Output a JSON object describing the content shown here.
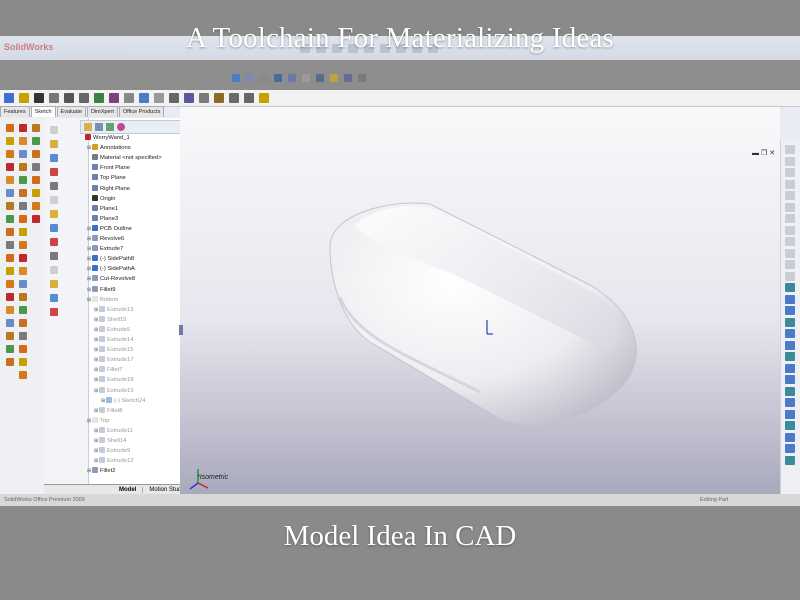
{
  "slide": {
    "title": "A Toolchain For Materializing Ideas",
    "caption": "Model Idea In CAD"
  },
  "app": {
    "name": "SolidWorks",
    "tabs": [
      "Features",
      "Sketch",
      "Evaluate",
      "DimXpert",
      "Office Products"
    ],
    "active_tab": "Sketch"
  },
  "feature_tree": {
    "items": [
      {
        "label": "WorryWand_1",
        "level": 0,
        "dim": false,
        "icon": "part-icon"
      },
      {
        "label": "Annotations",
        "level": 1,
        "dim": false,
        "icon": "annotations-icon"
      },
      {
        "label": "Material <not specified>",
        "level": 1,
        "dim": false,
        "icon": "material-icon"
      },
      {
        "label": "Front Plane",
        "level": 1,
        "dim": false,
        "icon": "plane-icon"
      },
      {
        "label": "Top Plane",
        "level": 1,
        "dim": false,
        "icon": "plane-icon"
      },
      {
        "label": "Right Plane",
        "level": 1,
        "dim": false,
        "icon": "plane-icon"
      },
      {
        "label": "Origin",
        "level": 1,
        "dim": false,
        "icon": "origin-icon"
      },
      {
        "label": "Plane1",
        "level": 1,
        "dim": false,
        "icon": "plane-icon"
      },
      {
        "label": "Plane3",
        "level": 1,
        "dim": false,
        "icon": "plane-icon"
      },
      {
        "label": "PCB Outline",
        "level": 1,
        "dim": false,
        "icon": "sketch-icon"
      },
      {
        "label": "Revolve6",
        "level": 1,
        "dim": false,
        "icon": "feature-icon"
      },
      {
        "label": "Extrude7",
        "level": 1,
        "dim": false,
        "icon": "feature-icon"
      },
      {
        "label": "(-) SidePath8",
        "level": 1,
        "dim": false,
        "icon": "sketch-icon"
      },
      {
        "label": "(-) SidePathA",
        "level": 1,
        "dim": false,
        "icon": "sketch-icon"
      },
      {
        "label": "Cut-Revolve8",
        "level": 1,
        "dim": false,
        "icon": "feature-icon"
      },
      {
        "label": "Fillet9",
        "level": 1,
        "dim": false,
        "icon": "feature-icon"
      },
      {
        "label": "Bottom",
        "level": 1,
        "dim": true,
        "icon": "folder-icon"
      },
      {
        "label": "Extrude13",
        "level": 2,
        "dim": true,
        "icon": "feature-icon"
      },
      {
        "label": "Shell15",
        "level": 2,
        "dim": true,
        "icon": "feature-icon"
      },
      {
        "label": "Extrude5",
        "level": 2,
        "dim": true,
        "icon": "feature-icon"
      },
      {
        "label": "Extrude14",
        "level": 2,
        "dim": true,
        "icon": "feature-icon"
      },
      {
        "label": "Extrude15",
        "level": 2,
        "dim": true,
        "icon": "feature-icon"
      },
      {
        "label": "Extrude17",
        "level": 2,
        "dim": true,
        "icon": "feature-icon"
      },
      {
        "label": "Fillet7",
        "level": 2,
        "dim": true,
        "icon": "feature-icon"
      },
      {
        "label": "Extrude18",
        "level": 2,
        "dim": true,
        "icon": "feature-icon"
      },
      {
        "label": "Extrude19",
        "level": 2,
        "dim": true,
        "icon": "feature-icon"
      },
      {
        "label": "(-) Sketch24",
        "level": 3,
        "dim": true,
        "icon": "sketch-icon"
      },
      {
        "label": "Fillet8",
        "level": 2,
        "dim": true,
        "icon": "feature-icon"
      },
      {
        "label": "Top",
        "level": 1,
        "dim": true,
        "icon": "folder-icon"
      },
      {
        "label": "Extrude11",
        "level": 2,
        "dim": true,
        "icon": "feature-icon"
      },
      {
        "label": "Shell14",
        "level": 2,
        "dim": true,
        "icon": "feature-icon"
      },
      {
        "label": "Extrude9",
        "level": 2,
        "dim": true,
        "icon": "feature-icon"
      },
      {
        "label": "Extrude12",
        "level": 2,
        "dim": true,
        "icon": "feature-icon"
      },
      {
        "label": "Fillet2",
        "level": 1,
        "dim": false,
        "icon": "feature-icon"
      }
    ]
  },
  "bottom_tabs": [
    "Model",
    "Motion Study 1"
  ],
  "status": {
    "left": "SolidWorks Office Premium 2009",
    "right": "Editing Part"
  },
  "viewport": {
    "view_label": "*Isometric"
  },
  "colors": {
    "slide_bg": "#8a8a8a",
    "viewport_top": "#f9f9fb",
    "viewport_bottom": "#a9a9bd",
    "model_fill": "#f1f1f4",
    "axis_x": "#c0282d",
    "axis_y": "#2a9a3a",
    "axis_z": "#2a3fbf"
  }
}
